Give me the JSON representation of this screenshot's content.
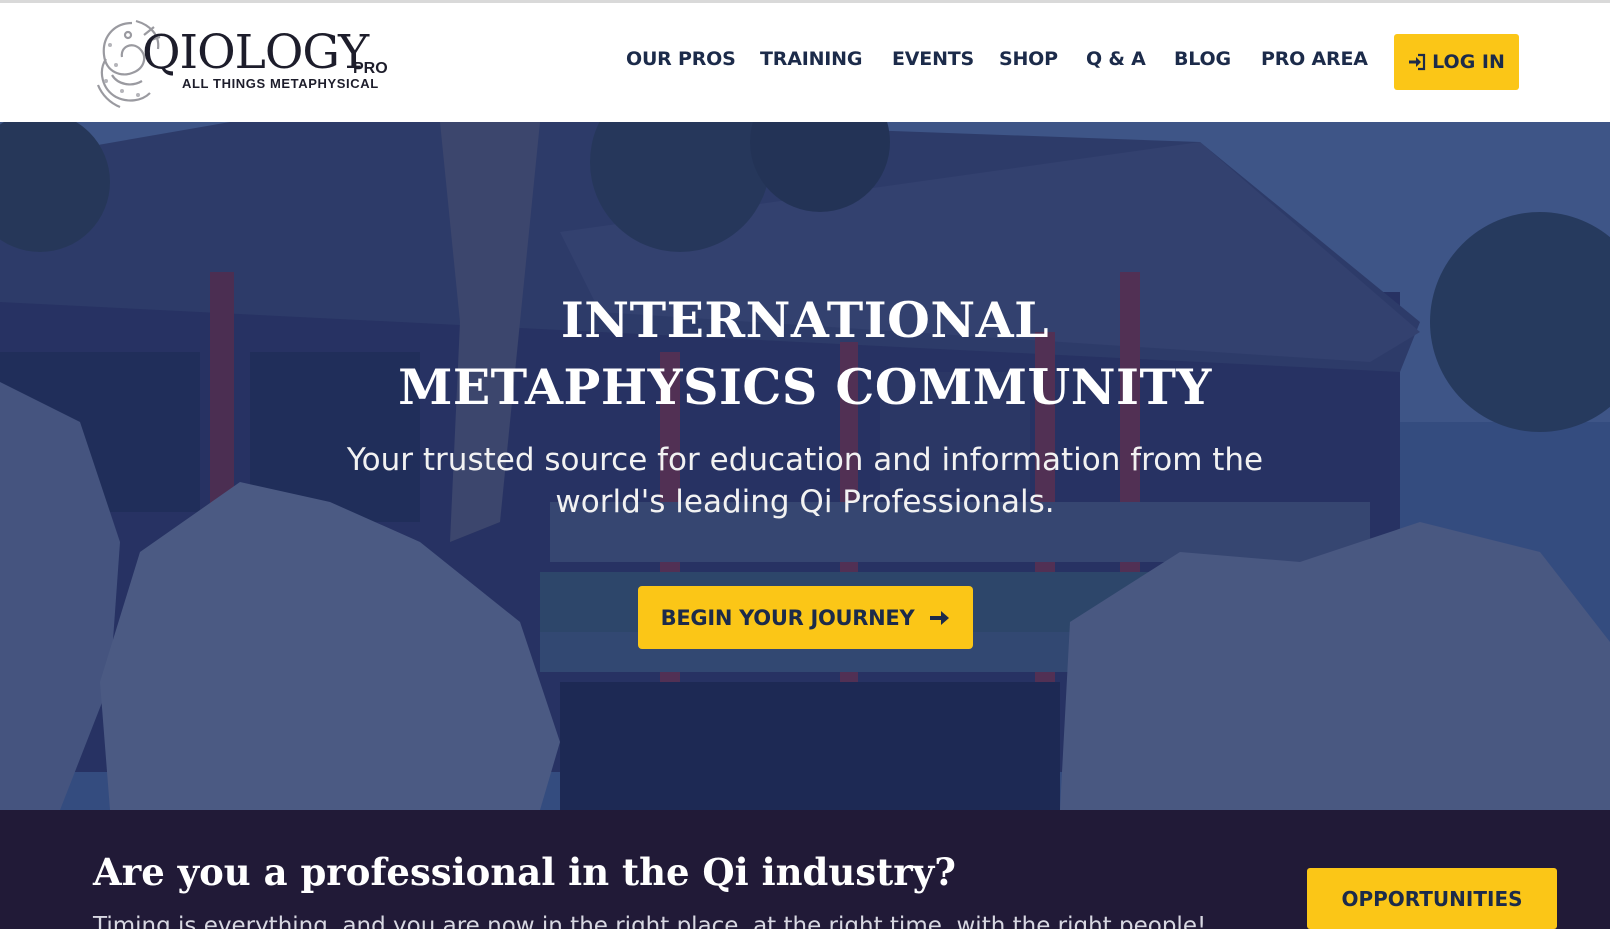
{
  "header": {
    "logo": {
      "wordmark": "QIOLOGY",
      "suffix": "PRO",
      "tagline": "ALL THINGS METAPHYSICAL"
    },
    "nav": [
      {
        "label": "OUR PROS"
      },
      {
        "label": "TRAINING"
      },
      {
        "label": "EVENTS"
      },
      {
        "label": "SHOP"
      },
      {
        "label": "Q & A"
      },
      {
        "label": "BLOG"
      },
      {
        "label": "PRO AREA"
      }
    ],
    "login": {
      "label": "LOG IN",
      "icon": "sign-in-icon"
    }
  },
  "hero": {
    "title_line1": "INTERNATIONAL",
    "title_line2": "METAPHYSICS COMMUNITY",
    "subtitle_line1": "Your trusted source for education and information from the",
    "subtitle_line2": "world's leading Qi Professionals.",
    "cta": {
      "label": "BEGIN YOUR JOURNEY",
      "icon": "arrow-right-icon"
    }
  },
  "band": {
    "title": "Are you a professional in the Qi industry?",
    "text": "Timing is everything, and you are now in the right place, at the right time, with the right people!",
    "button": {
      "label": "OPPORTUNITIES"
    }
  },
  "colors": {
    "accent": "#fbc617",
    "navy": "#1c2b4a",
    "band_bg": "#211a37",
    "hero_overlay": "#16285c"
  }
}
